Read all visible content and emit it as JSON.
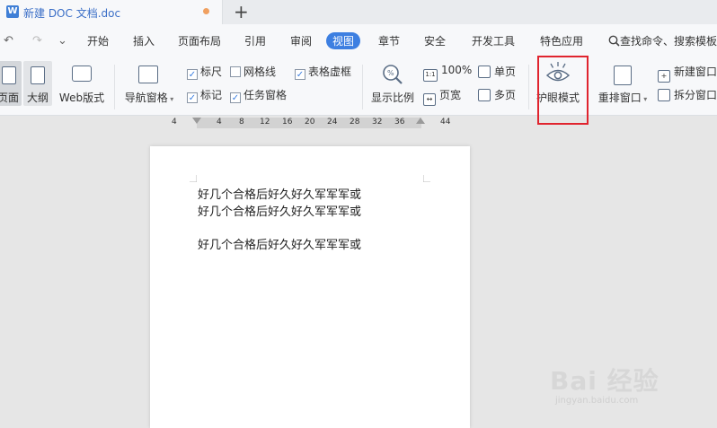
{
  "tab": {
    "icon": "W",
    "title": "新建 DOC 文档.doc",
    "new_tab": "+"
  },
  "quick_access": {
    "undo": "↶",
    "redo": "↷",
    "more": "⌄"
  },
  "menu": [
    {
      "label": "开始"
    },
    {
      "label": "插入"
    },
    {
      "label": "页面布局"
    },
    {
      "label": "引用"
    },
    {
      "label": "审阅"
    },
    {
      "label": "视图"
    },
    {
      "label": "章节"
    },
    {
      "label": "安全"
    },
    {
      "label": "开发工具"
    },
    {
      "label": "特色应用"
    }
  ],
  "active_menu": "视图",
  "search": {
    "label": "查找命令、搜索模板"
  },
  "ribbon": {
    "page_view": "页面",
    "outline": "大纲",
    "web_layout": "Web版式",
    "nav_pane": "导航窗格",
    "ruler": "标尺",
    "gridlines": "网格线",
    "table_gridlines": "表格虚框",
    "marks": "标记",
    "task_pane": "任务窗格",
    "zoom": "显示比例",
    "zoom_100": "100%",
    "single_page": "单页",
    "page_width": "页宽",
    "multi_page": "多页",
    "eye_mode": "护眼模式",
    "arrange_window": "重排窗口",
    "new_window": "新建窗口",
    "split_window": "拆分窗口"
  },
  "checkboxes": {
    "ruler": true,
    "gridlines": false,
    "table_gridlines": true,
    "marks": true,
    "task_pane": true
  },
  "ruler_numbers": [
    "4",
    "4",
    "8",
    "12",
    "16",
    "20",
    "24",
    "28",
    "32",
    "36",
    "44"
  ],
  "document": {
    "lines": [
      "好几个合格后好久好久军军军或",
      "好几个合格后好久好久军军军或",
      "好几个合格后好久好久军军军或"
    ]
  },
  "watermark": {
    "brand": "Bai 经验",
    "url": "jingyan.baidu.com"
  },
  "colors": {
    "accent": "#3d7fe1",
    "highlight": "#e0242e",
    "canvas": "#e6e6e6"
  }
}
